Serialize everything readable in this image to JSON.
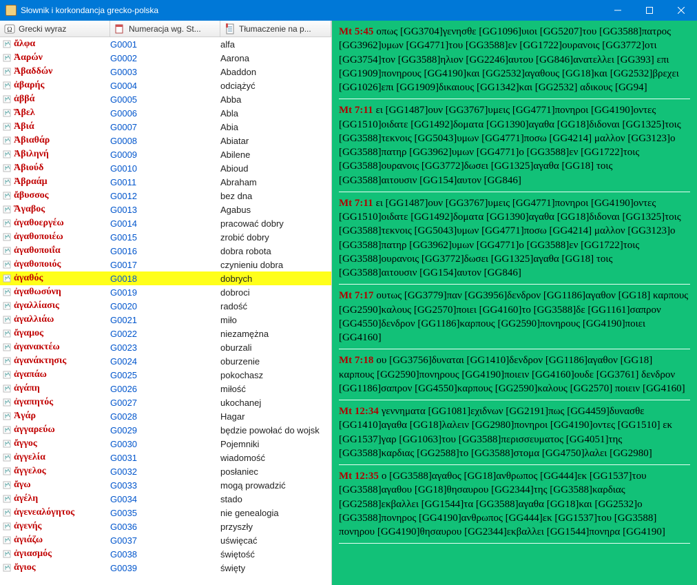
{
  "window": {
    "title": "Słownik i korkondancja grecko-polska"
  },
  "columns": {
    "c1": "Grecki wyraz",
    "c2": "Numeracja wg. St...",
    "c3": "Tłumaczenie na p..."
  },
  "rows": [
    {
      "greek": "ἄλφα",
      "num": "G0001",
      "trans": "alfa",
      "sel": false
    },
    {
      "greek": "Ἀαρών",
      "num": "G0002",
      "trans": "Aarona",
      "sel": false
    },
    {
      "greek": "Ἀβαδδών",
      "num": "G0003",
      "trans": "Abaddon",
      "sel": false
    },
    {
      "greek": "ἀβαρής",
      "num": "G0004",
      "trans": "odciążyć",
      "sel": false
    },
    {
      "greek": "ἀββά",
      "num": "G0005",
      "trans": "Abba",
      "sel": false
    },
    {
      "greek": "Ἅβελ",
      "num": "G0006",
      "trans": "Abla",
      "sel": false
    },
    {
      "greek": "Ἀβιά",
      "num": "G0007",
      "trans": "Abia",
      "sel": false
    },
    {
      "greek": "Ἀβιαθάρ",
      "num": "G0008",
      "trans": "Abiatar",
      "sel": false
    },
    {
      "greek": "Ἀβιληνή",
      "num": "G0009",
      "trans": "Abilene",
      "sel": false
    },
    {
      "greek": "Ἀβιούδ",
      "num": "G0010",
      "trans": "Abioud",
      "sel": false
    },
    {
      "greek": "Ἀβραάμ",
      "num": "G0011",
      "trans": "Abraham",
      "sel": false
    },
    {
      "greek": "ἄβυσσος",
      "num": "G0012",
      "trans": "bez dna",
      "sel": false
    },
    {
      "greek": "Ἅγαβος",
      "num": "G0013",
      "trans": "Agabus",
      "sel": false
    },
    {
      "greek": "ἀγαθοεργέω",
      "num": "G0014",
      "trans": "pracować dobry",
      "sel": false
    },
    {
      "greek": "ἀγαθοποιέω",
      "num": "G0015",
      "trans": "zrobić dobry",
      "sel": false
    },
    {
      "greek": "ἀγαθοποιΐα",
      "num": "G0016",
      "trans": "dobra robota",
      "sel": false
    },
    {
      "greek": "ἀγαθοποιός",
      "num": "G0017",
      "trans": "czynieniu dobra",
      "sel": false
    },
    {
      "greek": "ἀγαθός",
      "num": "G0018",
      "trans": "dobrych",
      "sel": true
    },
    {
      "greek": "ἀγαθωσύνη",
      "num": "G0019",
      "trans": "dobroci",
      "sel": false
    },
    {
      "greek": "ἀγαλλίασις",
      "num": "G0020",
      "trans": "radość",
      "sel": false
    },
    {
      "greek": "ἀγαλλιάω",
      "num": "G0021",
      "trans": "miło",
      "sel": false
    },
    {
      "greek": "ἄγαμος",
      "num": "G0022",
      "trans": "niezamężna",
      "sel": false
    },
    {
      "greek": "ἀγανακτέω",
      "num": "G0023",
      "trans": "oburzali",
      "sel": false
    },
    {
      "greek": "ἀγανάκτησις",
      "num": "G0024",
      "trans": "oburzenie",
      "sel": false
    },
    {
      "greek": "ἀγαπάω",
      "num": "G0025",
      "trans": "pokochasz",
      "sel": false
    },
    {
      "greek": "ἀγάπη",
      "num": "G0026",
      "trans": "miłość",
      "sel": false
    },
    {
      "greek": "ἀγαπητός",
      "num": "G0027",
      "trans": "ukochanej",
      "sel": false
    },
    {
      "greek": "Ἁγάρ",
      "num": "G0028",
      "trans": "Hagar",
      "sel": false
    },
    {
      "greek": "ἀγγαρεύω",
      "num": "G0029",
      "trans": "będzie powołać do wojsk",
      "sel": false
    },
    {
      "greek": "ἄγγος",
      "num": "G0030",
      "trans": "Pojemniki",
      "sel": false
    },
    {
      "greek": "ἀγγελία",
      "num": "G0031",
      "trans": "wiadomość",
      "sel": false
    },
    {
      "greek": "ἄγγελος",
      "num": "G0032",
      "trans": "posłaniec",
      "sel": false
    },
    {
      "greek": "ἄγω",
      "num": "G0033",
      "trans": "mogą prowadzić",
      "sel": false
    },
    {
      "greek": "ἀγέλη",
      "num": "G0034",
      "trans": "stado",
      "sel": false
    },
    {
      "greek": "ἀγενεαλόγητος",
      "num": "G0035",
      "trans": "nie genealogia",
      "sel": false
    },
    {
      "greek": "ἀγενής",
      "num": "G0036",
      "trans": "przyszły",
      "sel": false
    },
    {
      "greek": "ἁγιάζω",
      "num": "G0037",
      "trans": "uświęcać",
      "sel": false
    },
    {
      "greek": "ἁγιασμός",
      "num": "G0038",
      "trans": "świętość",
      "sel": false
    },
    {
      "greek": "ἅγιος",
      "num": "G0039",
      "trans": "święty",
      "sel": false
    }
  ],
  "verses": [
    {
      "ref": "Mt 5:45",
      "text": "οπως [GG3704]γενησθε [GG1096]υιοι [GG5207]του [GG3588]πατρος [GG3962]υμων [GG4771]του [GG3588]εν [GG1722]ουρανοις [GG3772]οτι [GG3754]τον [GG3588]ηλιον [GG2246]αυτου [GG846]ανατελλει [GG393] επι [GG1909]πονηρους [GG4190]και [GG2532]αγαθους [GG18]και [GG2532]βρεχει [GG1026]επι [GG1909]δικαιους [GG1342]και [GG2532] αδικους [GG94]"
    },
    {
      "ref": "Mt 7:11",
      "text": "ει [GG1487]ουν [GG3767]υμεις [GG4771]πονηροι [GG4190]οντες [GG1510]οιδατε [GG1492]δοματα [GG1390]αγαθα [GG18]διδοναι [GG1325]τοις [GG3588]τεκνοις [GG5043]υμων [GG4771]ποσω [GG4214] μαλλον [GG3123]ο [GG3588]πατηρ [GG3962]υμων [GG4771]ο [GG3588]εν [GG1722]τοις [GG3588]ουρανοις [GG3772]δωσει [GG1325]αγαθα [GG18] τοις [GG3588]αιτουσιν [GG154]αυτον [GG846]"
    },
    {
      "ref": "Mt 7:11",
      "text": "ει [GG1487]ουν [GG3767]υμεις [GG4771]πονηροι [GG4190]οντες [GG1510]οιδατε [GG1492]δοματα [GG1390]αγαθα [GG18]διδοναι [GG1325]τοις [GG3588]τεκνοις [GG5043]υμων [GG4771]ποσω [GG4214] μαλλον [GG3123]ο [GG3588]πατηρ [GG3962]υμων [GG4771]ο [GG3588]εν [GG1722]τοις [GG3588]ουρανοις [GG3772]δωσει [GG1325]αγαθα [GG18] τοις [GG3588]αιτουσιν [GG154]αυτον [GG846]"
    },
    {
      "ref": "Mt 7:17",
      "text": "ουτως [GG3779]παν [GG3956]δενδρον [GG1186]αγαθον [GG18] καρπους [GG2590]καλους [GG2570]ποιει [GG4160]το [GG3588]δε [GG1161]σαπρον [GG4550]δενδρον [GG1186]καρπους [GG2590]πονηρους [GG4190]ποιει [GG4160]"
    },
    {
      "ref": "Mt 7:18",
      "text": "ου [GG3756]δυναται [GG1410]δενδρον [GG1186]αγαθον [GG18] καρπους [GG2590]πονηρους [GG4190]ποιειν [GG4160]ουδε [GG3761] δενδρον [GG1186]σαπρον [GG4550]καρπους [GG2590]καλους [GG2570] ποιειν [GG4160]"
    },
    {
      "ref": "Mt 12:34",
      "text": "γεννηματα [GG1081]εχιδνων [GG2191]πως [GG4459]δυνασθε [GG1410]αγαθα [GG18]λαλειν [GG2980]πονηροι [GG4190]οντες [GG1510] εκ [GG1537]γαρ [GG1063]του [GG3588]περισσευματος [GG4051]της [GG3588]καρδιας [GG2588]το [GG3588]στομα [GG4750]λαλει [GG2980]"
    },
    {
      "ref": "Mt 12:35",
      "text": "ο [GG3588]αγαθος [GG18]ανθρωπος [GG444]εκ [GG1537]του [GG3588]αγαθου [GG18]θησαυρου [GG2344]της [GG3588]καρδιας [GG2588]εκβαλλει [GG1544]τα [GG3588]αγαθα [GG18]και [GG2532]ο [GG3588]πονηρος [GG4190]ανθρωπος [GG444]εκ [GG1537]του [GG3588] πονηρου [GG4190]θησαυρου [GG2344]εκβαλλει [GG1544]πονηρα [GG4190]"
    }
  ]
}
